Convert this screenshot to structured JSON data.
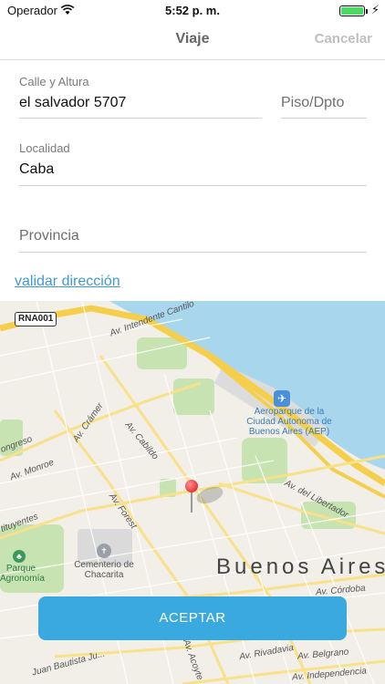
{
  "status_bar": {
    "carrier": "Operador",
    "time": "5:52 p. m.",
    "wifi_icon": "wifi-icon",
    "battery_icon": "battery-icon",
    "battery_level": 1.0,
    "charging_icon": "bolt-icon"
  },
  "nav": {
    "title": "Viaje",
    "cancel_label": "Cancelar"
  },
  "form": {
    "calle": {
      "label": "Calle y Altura",
      "value": "el salvador 5707"
    },
    "piso": {
      "placeholder": "Piso/Dpto"
    },
    "localidad": {
      "label": "Localidad",
      "value": "Caba"
    },
    "provincia": {
      "placeholder": "Provincia"
    }
  },
  "validate_link": "validar dirección",
  "map": {
    "route_badge": "RNA001",
    "city": "Buenos Aires",
    "streets": {
      "intendente_cantilo": "Av. Intendente Cantilo",
      "cramer": "Av. Crámer",
      "cabildo": "Av. Cabildo",
      "congreso": "ongreso",
      "monroe": "Av. Monroe",
      "forest": "Av. Forest",
      "libertador": "Av. del Libertador",
      "constituyentes": "tituyentes",
      "cordoba": "Av. Córdoba",
      "acoyte": "Av. Acoyte",
      "rivadavia": "Av. Rivadavia",
      "belgrano": "Av. Belgrano",
      "independencia": "Av. Independencia",
      "juan_bautista": "Juan Bautista Ju..."
    },
    "pois": {
      "airport": "Aeroparque de la Ciudad Autonoma de Buenos Aires (AEP)",
      "cemetery": "Cementerio de Chacarita",
      "park": "Parque Agronomía"
    },
    "colors": {
      "land": "#f2efe9",
      "water": "#a8d6ec",
      "park": "#c7e3b2",
      "highway": "#f5cf4c",
      "pin": "#d8121b"
    }
  },
  "accept_button": "ACEPTAR",
  "accent_color": "#39a9e0"
}
